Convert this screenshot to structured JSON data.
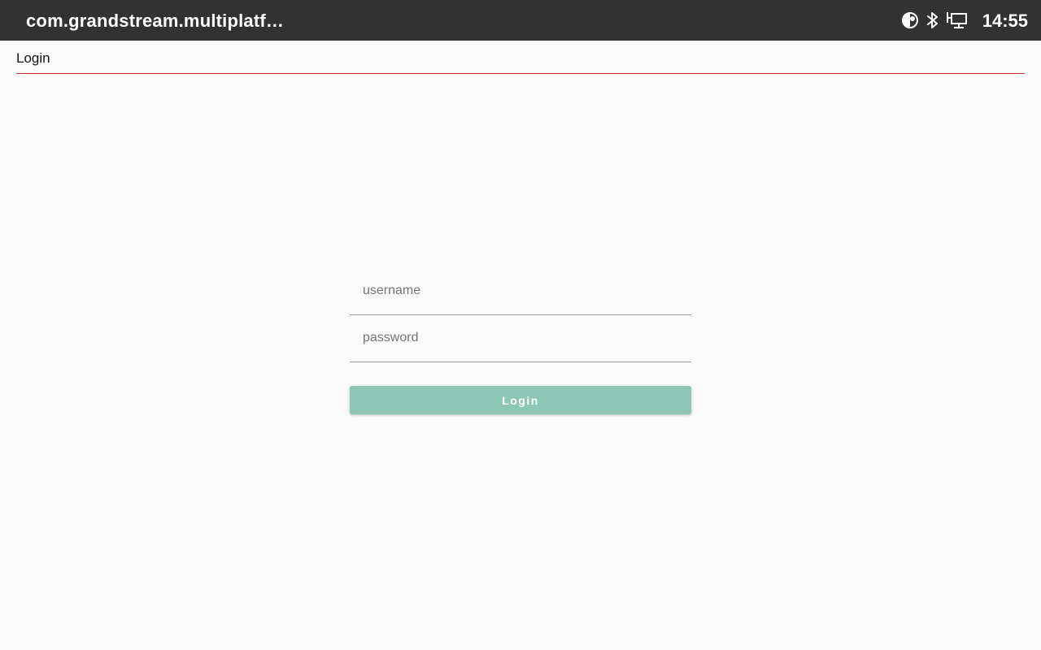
{
  "statusbar": {
    "app_title": "com.grandstream.multiplatf…",
    "time": "14:55",
    "icons": [
      "data-saver-icon",
      "bluetooth-icon",
      "ethernet-icon"
    ]
  },
  "header": {
    "title": "Login",
    "accent_color": "#c62828"
  },
  "form": {
    "username": {
      "value": "",
      "placeholder": "username"
    },
    "password": {
      "value": "",
      "placeholder": "password"
    },
    "login_label": "Login",
    "button_color": "#8cc7b5"
  }
}
